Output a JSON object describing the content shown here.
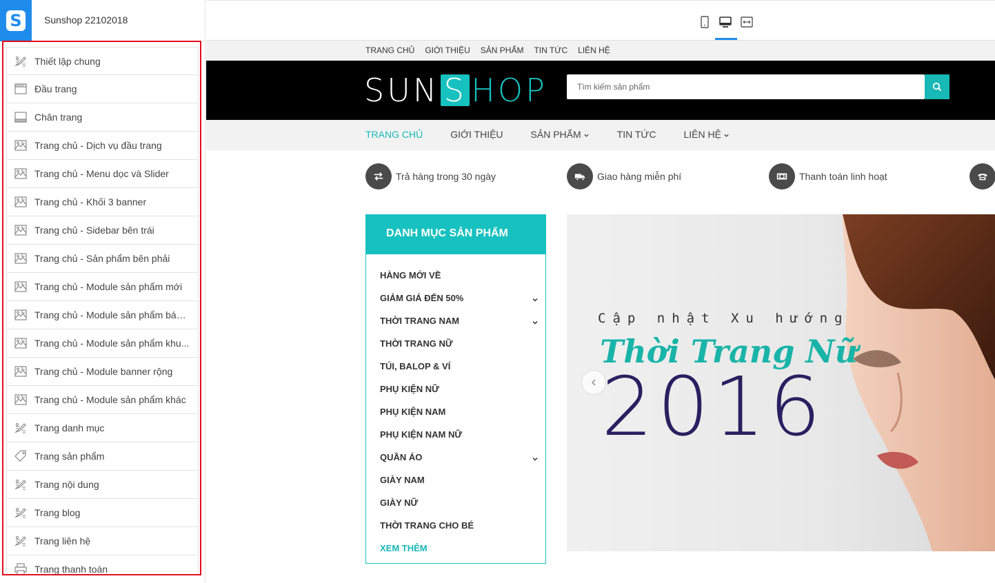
{
  "editor": {
    "shop_name": "Sunshop 22102018",
    "sections": [
      {
        "label": "Thiết lập chung",
        "icon": "brush-settings-icon"
      },
      {
        "label": "Đầu trang",
        "icon": "header-layout-icon"
      },
      {
        "label": "Chân trang",
        "icon": "footer-layout-icon"
      },
      {
        "label": "Trang chủ - Dịch vụ đầu trang",
        "icon": "homepage-image-icon"
      },
      {
        "label": "Trang chủ - Menu dọc và Slider",
        "icon": "homepage-image-icon"
      },
      {
        "label": "Trang chủ - Khối 3 banner",
        "icon": "homepage-image-icon"
      },
      {
        "label": "Trang chủ - Sidebar bên trái",
        "icon": "homepage-image-icon"
      },
      {
        "label": "Trang chủ - Sản phẩm bên phải",
        "icon": "homepage-image-icon"
      },
      {
        "label": "Trang chủ - Module sản phẩm mới",
        "icon": "homepage-image-icon"
      },
      {
        "label": "Trang chủ - Module sản phẩm bán...",
        "icon": "homepage-image-icon"
      },
      {
        "label": "Trang chủ - Module sản phẩm khu...",
        "icon": "homepage-image-icon"
      },
      {
        "label": "Trang chủ - Module banner rộng",
        "icon": "homepage-image-icon"
      },
      {
        "label": "Trang chủ - Module sản phẩm khác",
        "icon": "homepage-image-icon"
      },
      {
        "label": "Trang danh mục",
        "icon": "brush-settings-icon"
      },
      {
        "label": "Trang sản phẩm",
        "icon": "tag-icon"
      },
      {
        "label": "Trang nội dung",
        "icon": "brush-settings-icon"
      },
      {
        "label": "Trang blog",
        "icon": "brush-settings-icon"
      },
      {
        "label": "Trang liên hệ",
        "icon": "brush-settings-icon"
      },
      {
        "label": "Trang thanh toán",
        "icon": "printer-icon"
      }
    ]
  },
  "toolbar": {
    "devices": [
      {
        "name": "mobile-view-icon",
        "active": false
      },
      {
        "name": "desktop-view-icon",
        "active": true
      },
      {
        "name": "fullwidth-view-icon",
        "active": false
      }
    ],
    "accent": "#1f8ceb"
  },
  "site": {
    "top_links": [
      "TRANG CHỦ",
      "GIỚI THIỆU",
      "SẢN PHẨM",
      "TIN TỨC",
      "LIÊN HỆ"
    ],
    "brand": {
      "part1": "SUN",
      "bag_letter": "S",
      "part2": "HOP",
      "color": "#17c1c0"
    },
    "search_placeholder": "Tìm kiếm sản phẩm",
    "nav": [
      {
        "label": "TRANG CHỦ",
        "active": true
      },
      {
        "label": "GIỚI THIỆU",
        "active": false
      },
      {
        "label": "SẢN PHẨM",
        "active": false,
        "dropdown": true
      },
      {
        "label": "TIN TỨC",
        "active": false
      },
      {
        "label": "LIÊN HỆ",
        "active": false,
        "dropdown": true
      }
    ],
    "services": [
      {
        "label": "Trả hàng trong 30 ngày",
        "icon": "exchange-arrows-icon"
      },
      {
        "label": "Giao hàng miễn phí",
        "icon": "truck-icon"
      },
      {
        "label": "Thanh toán linh hoạt",
        "icon": "cash-icon"
      },
      {
        "label": "",
        "icon": "phone-icon"
      }
    ],
    "categories_title": "DANH MỤC SẢN PHẨM",
    "categories": [
      {
        "label": "HÀNG MỚI VỀ",
        "sub": false
      },
      {
        "label": "GIẢM GIÁ ĐẾN 50%",
        "sub": true
      },
      {
        "label": "THỜI TRANG NAM",
        "sub": true
      },
      {
        "label": "THỜI TRANG NỮ",
        "sub": false
      },
      {
        "label": "TÚI, BALOP & VÍ",
        "sub": false
      },
      {
        "label": "PHỤ KIỆN NỮ",
        "sub": false
      },
      {
        "label": "PHỤ KIỆN NAM",
        "sub": false
      },
      {
        "label": "PHỤ KIỆN NAM NỮ",
        "sub": false
      },
      {
        "label": "QUẦN ÁO",
        "sub": true
      },
      {
        "label": "GIÀY NAM",
        "sub": false
      },
      {
        "label": "GIÀY NỮ",
        "sub": false
      },
      {
        "label": "THỜI TRANG CHO BÉ",
        "sub": false
      }
    ],
    "categories_more": "XEM THÊM",
    "banner": {
      "line1": "Cập nhật Xu hướng",
      "script": "Thời Trang Nữ",
      "year": "2016"
    }
  }
}
